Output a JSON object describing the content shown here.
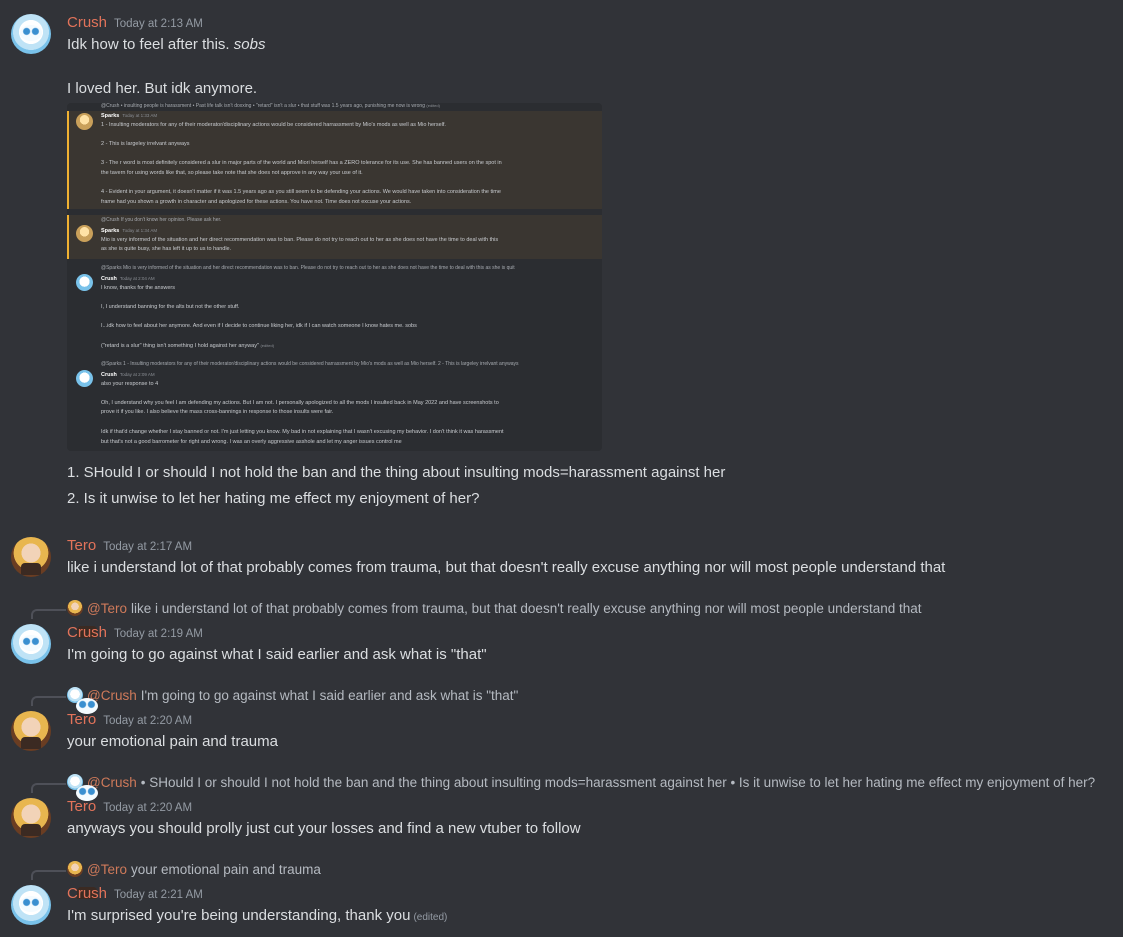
{
  "messages": {
    "m1": {
      "author": "Crush",
      "time": "Today at 2:13 AM",
      "line1": "Idk how to feel after this. ",
      "line1_italic": "sobs",
      "line2": "I loved her. But idk anymore.",
      "list1": "1. SHould I or should I not hold the ban and the thing about insulting mods=harassment against her",
      "list2": "2. Is it unwise to let her hating me effect my enjoyment of her?"
    },
    "m2": {
      "author": "Tero",
      "time": "Today at 2:17 AM",
      "text": "like i understand lot of that probably comes from trauma, but that doesn't really excuse anything nor will most people understand that"
    },
    "m3": {
      "reply_mention": "@Tero",
      "reply_text": "like i understand lot of that probably comes from trauma, but that doesn't really excuse anything nor will most people understand that",
      "author": "Crush",
      "time": "Today at 2:19 AM",
      "text": "I'm going to go against what I said earlier and ask what is \"that\""
    },
    "m4": {
      "reply_mention": "@Crush",
      "reply_text": "I'm going to go against what I said earlier and ask what is \"that\"",
      "author": "Tero",
      "time": "Today at 2:20 AM",
      "text": "your emotional pain and trauma"
    },
    "m5": {
      "reply_mention": "@Crush",
      "reply_text": "• SHould I or should I not hold the ban and the thing about insulting mods=harassment against her   • Is it unwise to let her hating me effect my enjoyment of her?",
      "author": "Tero",
      "time": "Today at 2:20 AM",
      "text": "anyways you should prolly just cut your losses and find a new vtuber to follow"
    },
    "m6": {
      "reply_mention": "@Tero",
      "reply_text": "your emotional pain and trauma",
      "author": "Crush",
      "time": "Today at 2:21 AM",
      "text": "I'm surprised you're being understanding, thank you",
      "edited": "(edited)"
    }
  },
  "screenshot": {
    "r1": "@Crush • insulting people is harassment • Past life talk isn't doxxing • \"retard\" isn't a slur • that stuff was 1.5 years ago, punishing me now is wrong",
    "r1_edited": "(edited)",
    "s1_name": "Sparks",
    "s1_time": "Today at 1:33 AM",
    "s1_l1": "1 - Insulting moderators for any of their moderator/disciplinary actions would be considered harrassment by Mio's mods as well as Mio herself.",
    "s1_l2": "2 - This is largeley irrelvant anyways",
    "s1_l3": "3 - The r word is most definitely considered a slur in major parts of the world and Miori herself has a ZERO tolerance for its use. She has banned users on the spot in",
    "s1_l4": "the tavern for using words like that, so please take note that she does not approve in any way your use of it.",
    "s1_l5": "4 - Evident in your argument, it doesn't matter if it was 1.5 years ago as you still seem to be defending your actions. We would have taken into consideration the time",
    "s1_l6": "frame had you shown a growth in character and apologized for these actions. You have not. Time does not excuse your actions.",
    "r2": "@Crush If you don't know her opinion. Please ask her.",
    "s2_name": "Sparks",
    "s2_time": "Today at 1:34 AM",
    "s2_l1": "Mio is very informed of the situation and her direct recommendation was to ban. Please do not try to reach out to her as she does not have the time to deal with this",
    "s2_l2": "as she is quite busy, she has left it up to us to handle.",
    "r3": "@Sparks Mio is very informed of the situation and her direct recommendation was to ban. Please do not try to reach out to her as she does not have the time to deal with this as she is quit",
    "c1_name": "Crush",
    "c1_time": "Today at 2:04 AM",
    "c1_l1": "I know, thanks for the answers",
    "c1_l2": "I, I understand banning for the alts but not the other stuff.",
    "c1_l3": "I...idk how to feel about her anymore. And even if I decide to continue liking her, idk if I can watch someone I know hates me. sobs",
    "c1_l4": "(\"retard is a slur\" thing isn't something I hold against her anyway\"",
    "c1_l4_edited": "(edited)",
    "r4": "@Sparks 1 - Insulting moderators for any of their moderator/disciplinary actions would be considered harrassment by Mio's mods as well as Mio herself. 2 - This is largeley irrelvant anyways",
    "c2_name": "Crush",
    "c2_time": "Today at 2:09 AM",
    "c2_l1": "also your response to 4",
    "c2_l2": "Oh, I understand why you feel I am defending my actions. But I am not. I personally apologized  to all the mods I insulted back in May 2022 and have screenshots to",
    "c2_l3": "prove it if you like. I also believe the mass cross-bannings in response to those insults were fair.",
    "c2_l4": "Idk if that'd change whether I stay banned or not. I'm just letting you know. My bad in not explaining that I wasn't excusing my behavior. I don't think it was harassment",
    "c2_l5": "but that's not a good barrometer for right and wrong. I was an overly aggressive asshole and let my anger issues control me"
  }
}
